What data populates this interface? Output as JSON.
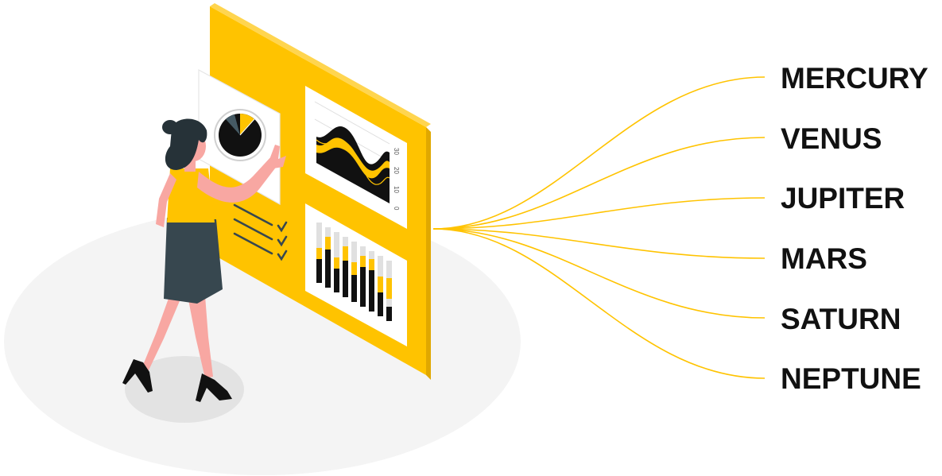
{
  "labels": [
    "MERCURY",
    "VENUS",
    "JUPITER",
    "MARS",
    "SATURN",
    "NEPTUNE"
  ],
  "colors": {
    "accent": "#FFC300",
    "dark": "#263238",
    "skin": "#F8A7A2",
    "floor": "#F4F4F4",
    "shadow": "#E3E3E3",
    "text": "#111111"
  },
  "wave_panel": {
    "tick_labels": [
      "30",
      "20",
      "10",
      "0"
    ]
  }
}
